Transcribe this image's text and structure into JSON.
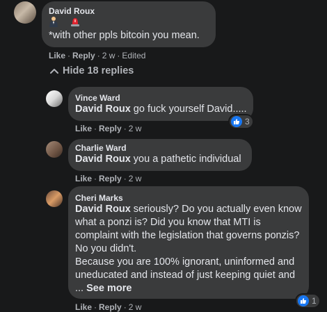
{
  "colors": {
    "background": "#18191a",
    "bubble": "#3a3b3c",
    "text": "#e4e6eb",
    "muted": "#b0b3b8",
    "like_blue": "#1877f2"
  },
  "main_comment": {
    "author": "David Roux",
    "emoji_icons": [
      "person-in-suit-icon",
      "police-siren-icon"
    ],
    "text": "*with other ppls bitcoin you mean.",
    "like": "Like",
    "reply": "Reply",
    "time": "2 w",
    "edited": "Edited"
  },
  "hide_replies_label": "Hide 18 replies",
  "replies": [
    {
      "author": "Vince Ward",
      "mention": "David Roux",
      "text": " go fuck yourself David.....",
      "like": "Like",
      "reply": "Reply",
      "time": "2 w",
      "reaction_count": "3"
    },
    {
      "author": "Charlie Ward",
      "mention": "David Roux",
      "text": " you a pathetic individual",
      "like": "Like",
      "reply": "Reply",
      "time": "2 w"
    },
    {
      "author": "Cheri Marks",
      "mention": "David Roux",
      "line1": " seriously? Do you actually even know",
      "line2": "what a ponzi is? Did you know that MTI is",
      "line3": "complaint with the legislation that governs ponzis?",
      "line4": "No you didn't.",
      "line5": "Because you are 100% ignorant, uninformed and",
      "line6": "uneducated and instead of just keeping quiet and",
      "line7_prefix": "... ",
      "see_more": "See more",
      "like": "Like",
      "reply": "Reply",
      "time": "2 w",
      "reaction_count": "1"
    }
  ]
}
